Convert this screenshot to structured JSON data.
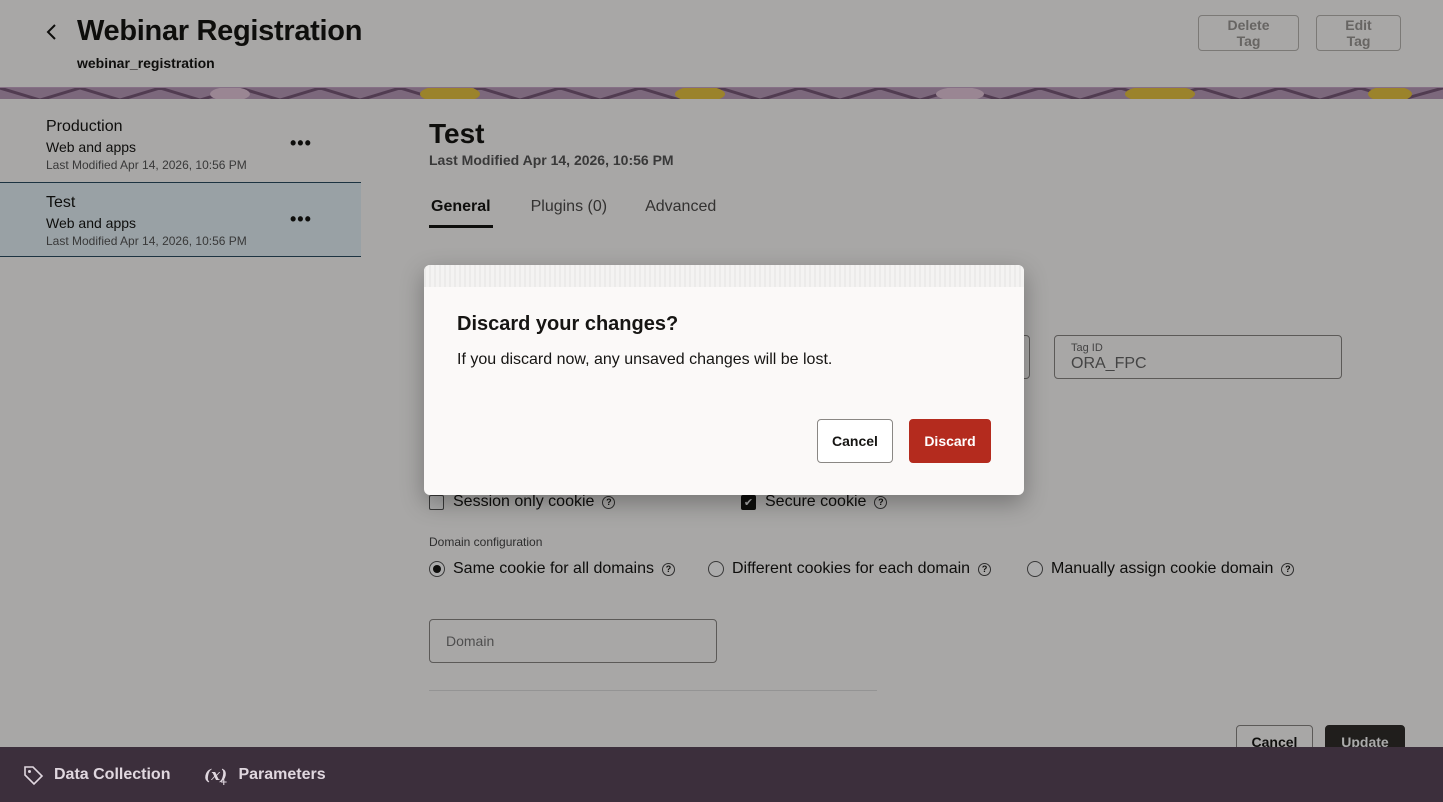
{
  "header": {
    "title": "Webinar Registration",
    "subtitle": "webinar_registration",
    "delete_label": "Delete Tag",
    "edit_label": "Edit Tag"
  },
  "sidebar": {
    "items": [
      {
        "name": "Production",
        "type": "Web and apps",
        "modified": "Last Modified Apr 14, 2026, 10:56 PM",
        "selected": false
      },
      {
        "name": "Test",
        "type": "Web and apps",
        "modified": "Last Modified Apr 14, 2026, 10:56 PM",
        "selected": true
      }
    ]
  },
  "content": {
    "title": "Test",
    "modified": "Last Modified Apr 14, 2026, 10:56 PM",
    "tabs": [
      {
        "label": "General",
        "active": true
      },
      {
        "label": "Plugins (0)",
        "active": false
      },
      {
        "label": "Advanced",
        "active": false
      }
    ],
    "tag_id": {
      "label": "Tag ID",
      "value": "ORA_FPC"
    },
    "session_cookie": {
      "label": "Session only cookie",
      "checked": false
    },
    "secure_cookie": {
      "label": "Secure cookie",
      "checked": true
    },
    "domain_config": {
      "label": "Domain configuration",
      "options": [
        {
          "label": "Same cookie for all domains",
          "selected": true
        },
        {
          "label": "Different cookies for each domain",
          "selected": false
        },
        {
          "label": "Manually assign cookie domain",
          "selected": false
        }
      ]
    },
    "domain_placeholder": "Domain",
    "cancel_label": "Cancel",
    "update_label": "Update"
  },
  "bottom_nav": {
    "items": [
      {
        "label": "Data Collection",
        "icon": "tag-icon"
      },
      {
        "label": "Parameters",
        "icon": "variable-icon"
      }
    ]
  },
  "dialog": {
    "title": "Discard your changes?",
    "body": "If you discard now, any unsaved changes will be lost.",
    "cancel_label": "Cancel",
    "discard_label": "Discard"
  },
  "colors": {
    "danger": "#b42b1e",
    "selected_bg": "#e4f1f7",
    "bottom_bar": "#3c2f3c"
  }
}
